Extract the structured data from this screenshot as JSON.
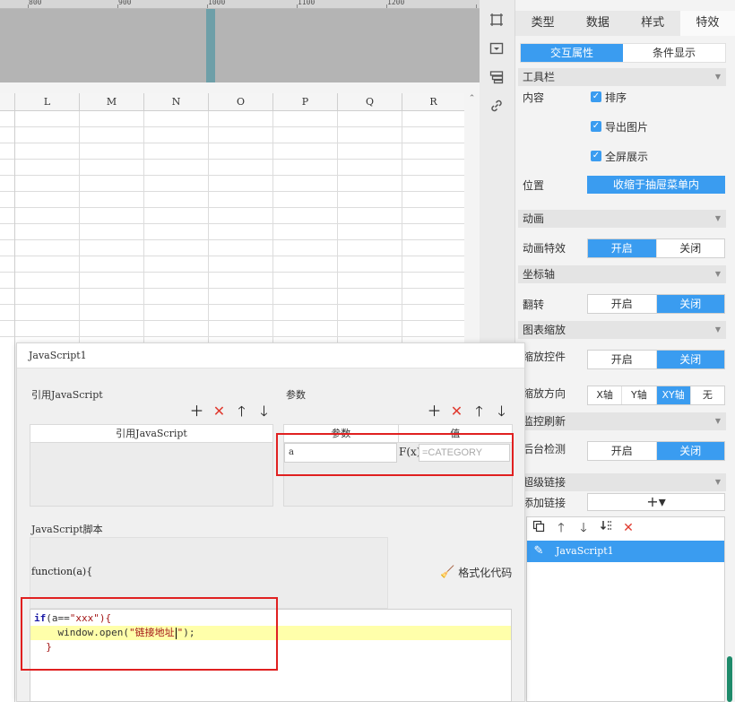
{
  "ruler": {
    "marks": [
      "800",
      "900",
      "1000",
      "1100",
      "1200"
    ]
  },
  "sheet": {
    "columns": [
      "L",
      "M",
      "N",
      "O",
      "P",
      "Q",
      "R"
    ]
  },
  "toolbar_icons": [
    "frame-icon",
    "dropdown-widget-icon",
    "layers-icon",
    "link-icon"
  ],
  "props": {
    "tabs": [
      "类型",
      "数据",
      "样式",
      "特效"
    ],
    "active_tab": "特效",
    "subtabs": [
      "交互属性",
      "条件显示"
    ],
    "toolbar_section": "工具栏",
    "content_label": "内容",
    "checkboxes": [
      "排序",
      "导出图片",
      "全屏展示"
    ],
    "position_label": "位置",
    "position_value": "收缩于抽屉菜单内",
    "animation_section": "动画",
    "animation_effect_label": "动画特效",
    "on": "开启",
    "off": "关闭",
    "axis_section": "坐标轴",
    "flip_label": "翻转",
    "zoom_section": "图表缩放",
    "zoom_control_label": "缩放控件",
    "zoom_direction_label": "缩放方向",
    "zoom_directions": [
      "X轴",
      "Y轴",
      "XY轴",
      "无"
    ],
    "refresh_section": "监控刷新",
    "background_check_label": "后台检测",
    "hyperlink_section": "超级链接",
    "add_link_label": "添加链接",
    "add_link_symbol": "+▾",
    "link_items": [
      "JavaScript1"
    ]
  },
  "dialog": {
    "title": "JavaScript1",
    "ref_title": "引用JavaScript",
    "ref_header": "引用JavaScript",
    "param_title": "参数",
    "param_headers": [
      "参数",
      "值"
    ],
    "param_name": "a",
    "param_value_placeholder": "=CATEGORY",
    "fx_label": "F(x)",
    "script_title": "JavaScript脚本",
    "function_sig": "function(a){",
    "format_label": "格式化代码",
    "code": {
      "line1_kw": "if",
      "line1_pre": "(a==",
      "line1_str": "\"xxx\"",
      "line1_post": "){",
      "line2_pre": "    window.open(",
      "line2_str": "\"链接地址",
      "line2_str_end": "\"",
      "line2_post": ");",
      "line3": "  }"
    }
  }
}
